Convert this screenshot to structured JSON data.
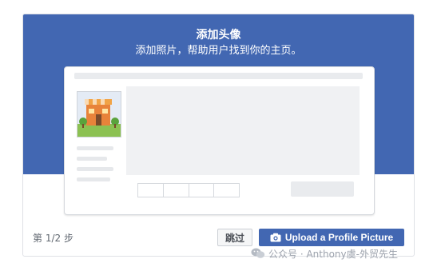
{
  "header": {
    "title": "添加头像",
    "subtitle": "添加照片，帮助用户找到你的主页。"
  },
  "footer": {
    "step": "第 1/2 步",
    "skip_label": "跳过",
    "upload_label": "Upload a Profile Picture"
  },
  "watermark": {
    "text": "公众号 · Anthony虞-外贸先生"
  },
  "icons": {
    "upload": "camera-icon",
    "avatar": "storefront-icon",
    "watermark": "wechat-icon"
  },
  "colors": {
    "brand": "#4267b2",
    "page_bg": "#ffffff",
    "placeholder": "#e9ebee"
  }
}
